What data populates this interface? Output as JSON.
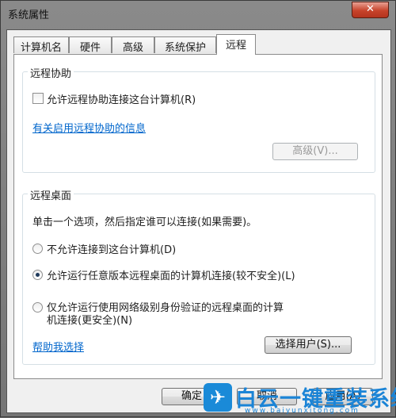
{
  "window": {
    "title": "系统属性",
    "close_label": "✕"
  },
  "tabs": [
    {
      "label": "计算机名"
    },
    {
      "label": "硬件"
    },
    {
      "label": "高级"
    },
    {
      "label": "系统保护"
    },
    {
      "label": "远程",
      "active": true
    }
  ],
  "remote_assistance": {
    "legend": "远程协助",
    "checkbox_label": "允许远程协助连接这台计算机(R)",
    "checked": false,
    "info_link": "有关启用远程协助的信息",
    "advanced_button": "高级(V)..."
  },
  "remote_desktop": {
    "legend": "远程桌面",
    "description": "单击一个选项，然后指定谁可以连接(如果需要)。",
    "options": [
      {
        "label": "不允许连接到这台计算机(D)",
        "checked": false
      },
      {
        "label": "允许运行任意版本远程桌面的计算机连接(较不安全)(L)",
        "checked": true
      },
      {
        "label_line1": "仅允许运行使用网络级别身份验证的远程桌面的计算",
        "label_line2": "机连接(更安全)(N)",
        "checked": false
      }
    ],
    "help_link": "帮助我选择",
    "select_users_button": "选择用户(S)..."
  },
  "footer": {
    "ok_button": "确定",
    "cancel_button": "取消",
    "apply_button": "应用(A)"
  },
  "watermark": {
    "brand": "白云一键重装系统",
    "url": "www.baiyunxitong.com"
  }
}
